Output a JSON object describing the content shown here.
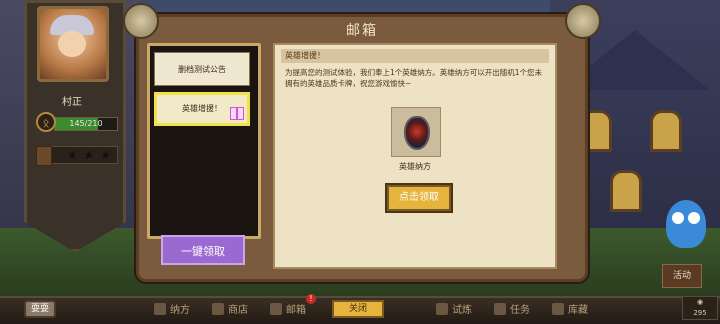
{
  "hero": {
    "name": "村正",
    "xp_text": "145/210",
    "xp_fraction": 0.69,
    "stars_total": 3
  },
  "dialog": {
    "title": "邮箱"
  },
  "mail_list": [
    {
      "label": "删档测试公告"
    },
    {
      "label": "英雄增援！"
    }
  ],
  "collect_all_label": "一键领取",
  "mail_content": {
    "heading": "英雄增援！",
    "body": "为提高您的测试体验，我们奉上1个英雄纳方。英雄纳方可以开出随机1个您未拥有的英雄品质卡牌，祝您游戏愉快~",
    "item_name": "英雄纳方",
    "claim_label": "点击领取"
  },
  "bottom_nav": [
    {
      "label": "纳方",
      "icon": "cauldron-icon"
    },
    {
      "label": "商店",
      "icon": "shop-icon"
    },
    {
      "label": "邮箱",
      "icon": "mail-icon",
      "badge": "!"
    },
    {
      "label": "试炼",
      "icon": "trial-icon"
    },
    {
      "label": "任务",
      "icon": "task-icon"
    },
    {
      "label": "库藏",
      "icon": "storage-icon"
    }
  ],
  "close_label": "关闭",
  "activity_label": "活动",
  "chat_label": "耍耍",
  "coins_text": "295"
}
